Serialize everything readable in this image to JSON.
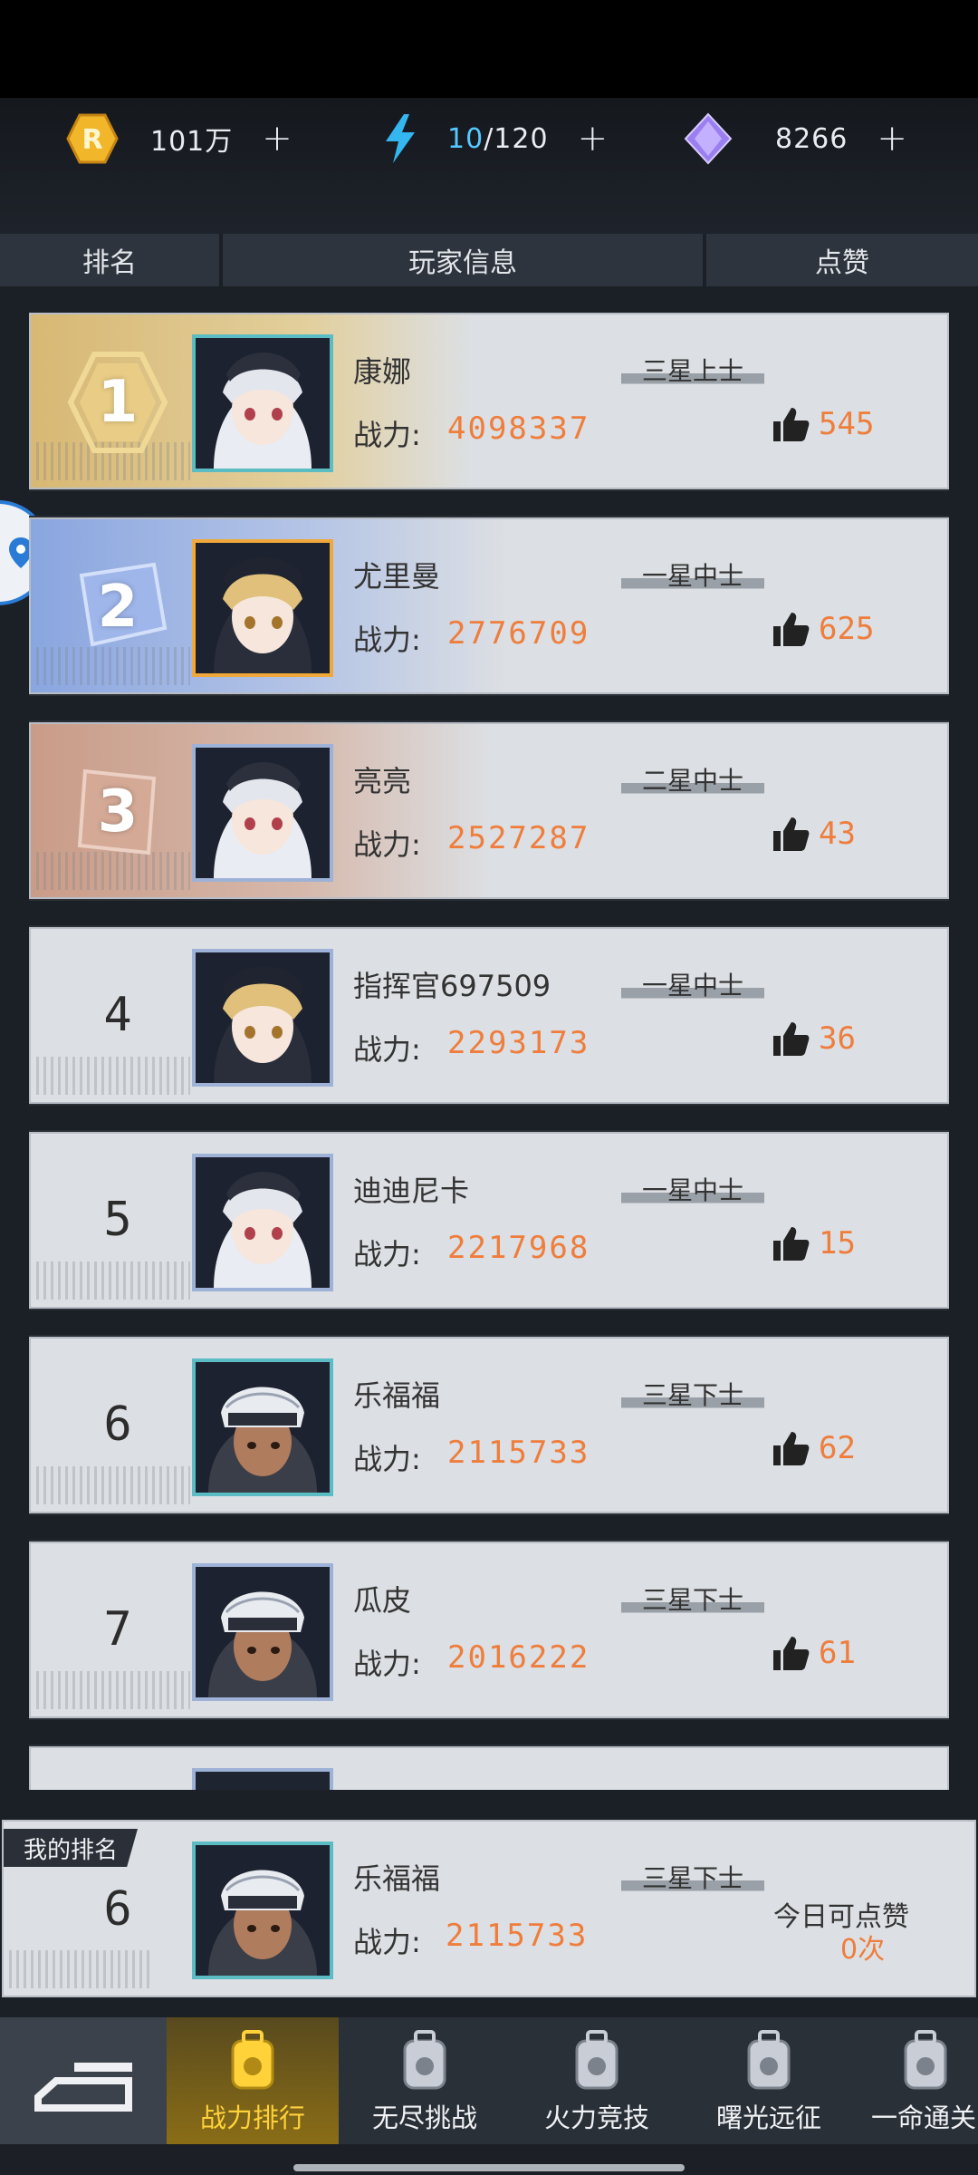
{
  "currency": {
    "gold": {
      "value": "101万",
      "plus": "+"
    },
    "energy": {
      "current": "10",
      "max": "/120",
      "plus": "+"
    },
    "gems": {
      "value": "8266",
      "plus": "+"
    }
  },
  "columns": {
    "rank": "排名",
    "player": "玩家信息",
    "likes": "点赞"
  },
  "labels": {
    "power": "战力:"
  },
  "rows": [
    {
      "rank": "1",
      "name": "康娜",
      "power": "4098337",
      "title": "三星上士",
      "likes": "545"
    },
    {
      "rank": "2",
      "name": "尤里曼",
      "power": "2776709",
      "title": "一星中士",
      "likes": "625"
    },
    {
      "rank": "3",
      "name": "亮亮",
      "power": "2527287",
      "title": "二星中士",
      "likes": "43"
    },
    {
      "rank": "4",
      "name": "指挥官697509",
      "power": "2293173",
      "title": "一星中士",
      "likes": "36"
    },
    {
      "rank": "5",
      "name": "迪迪尼卡",
      "power": "2217968",
      "title": "一星中士",
      "likes": "15"
    },
    {
      "rank": "6",
      "name": "乐福福",
      "power": "2115733",
      "title": "三星下士",
      "likes": "62"
    },
    {
      "rank": "7",
      "name": "瓜皮",
      "power": "2016222",
      "title": "三星下士",
      "likes": "61"
    }
  ],
  "my_rank": {
    "tag": "我的排名",
    "rank": "6",
    "name": "乐福福",
    "power": "2115733",
    "title": "三星下士",
    "today_label": "今日可点赞",
    "today_value": "0次"
  },
  "nav": [
    {
      "label": "战力排行",
      "active": true
    },
    {
      "label": "无尽挑战"
    },
    {
      "label": "火力竞技"
    },
    {
      "label": "曙光远征"
    },
    {
      "label": "一命通关"
    }
  ],
  "colors": {
    "accent": "#ef7d3c",
    "energy": "#55c8ff",
    "active_tab": "#ffd23a"
  }
}
